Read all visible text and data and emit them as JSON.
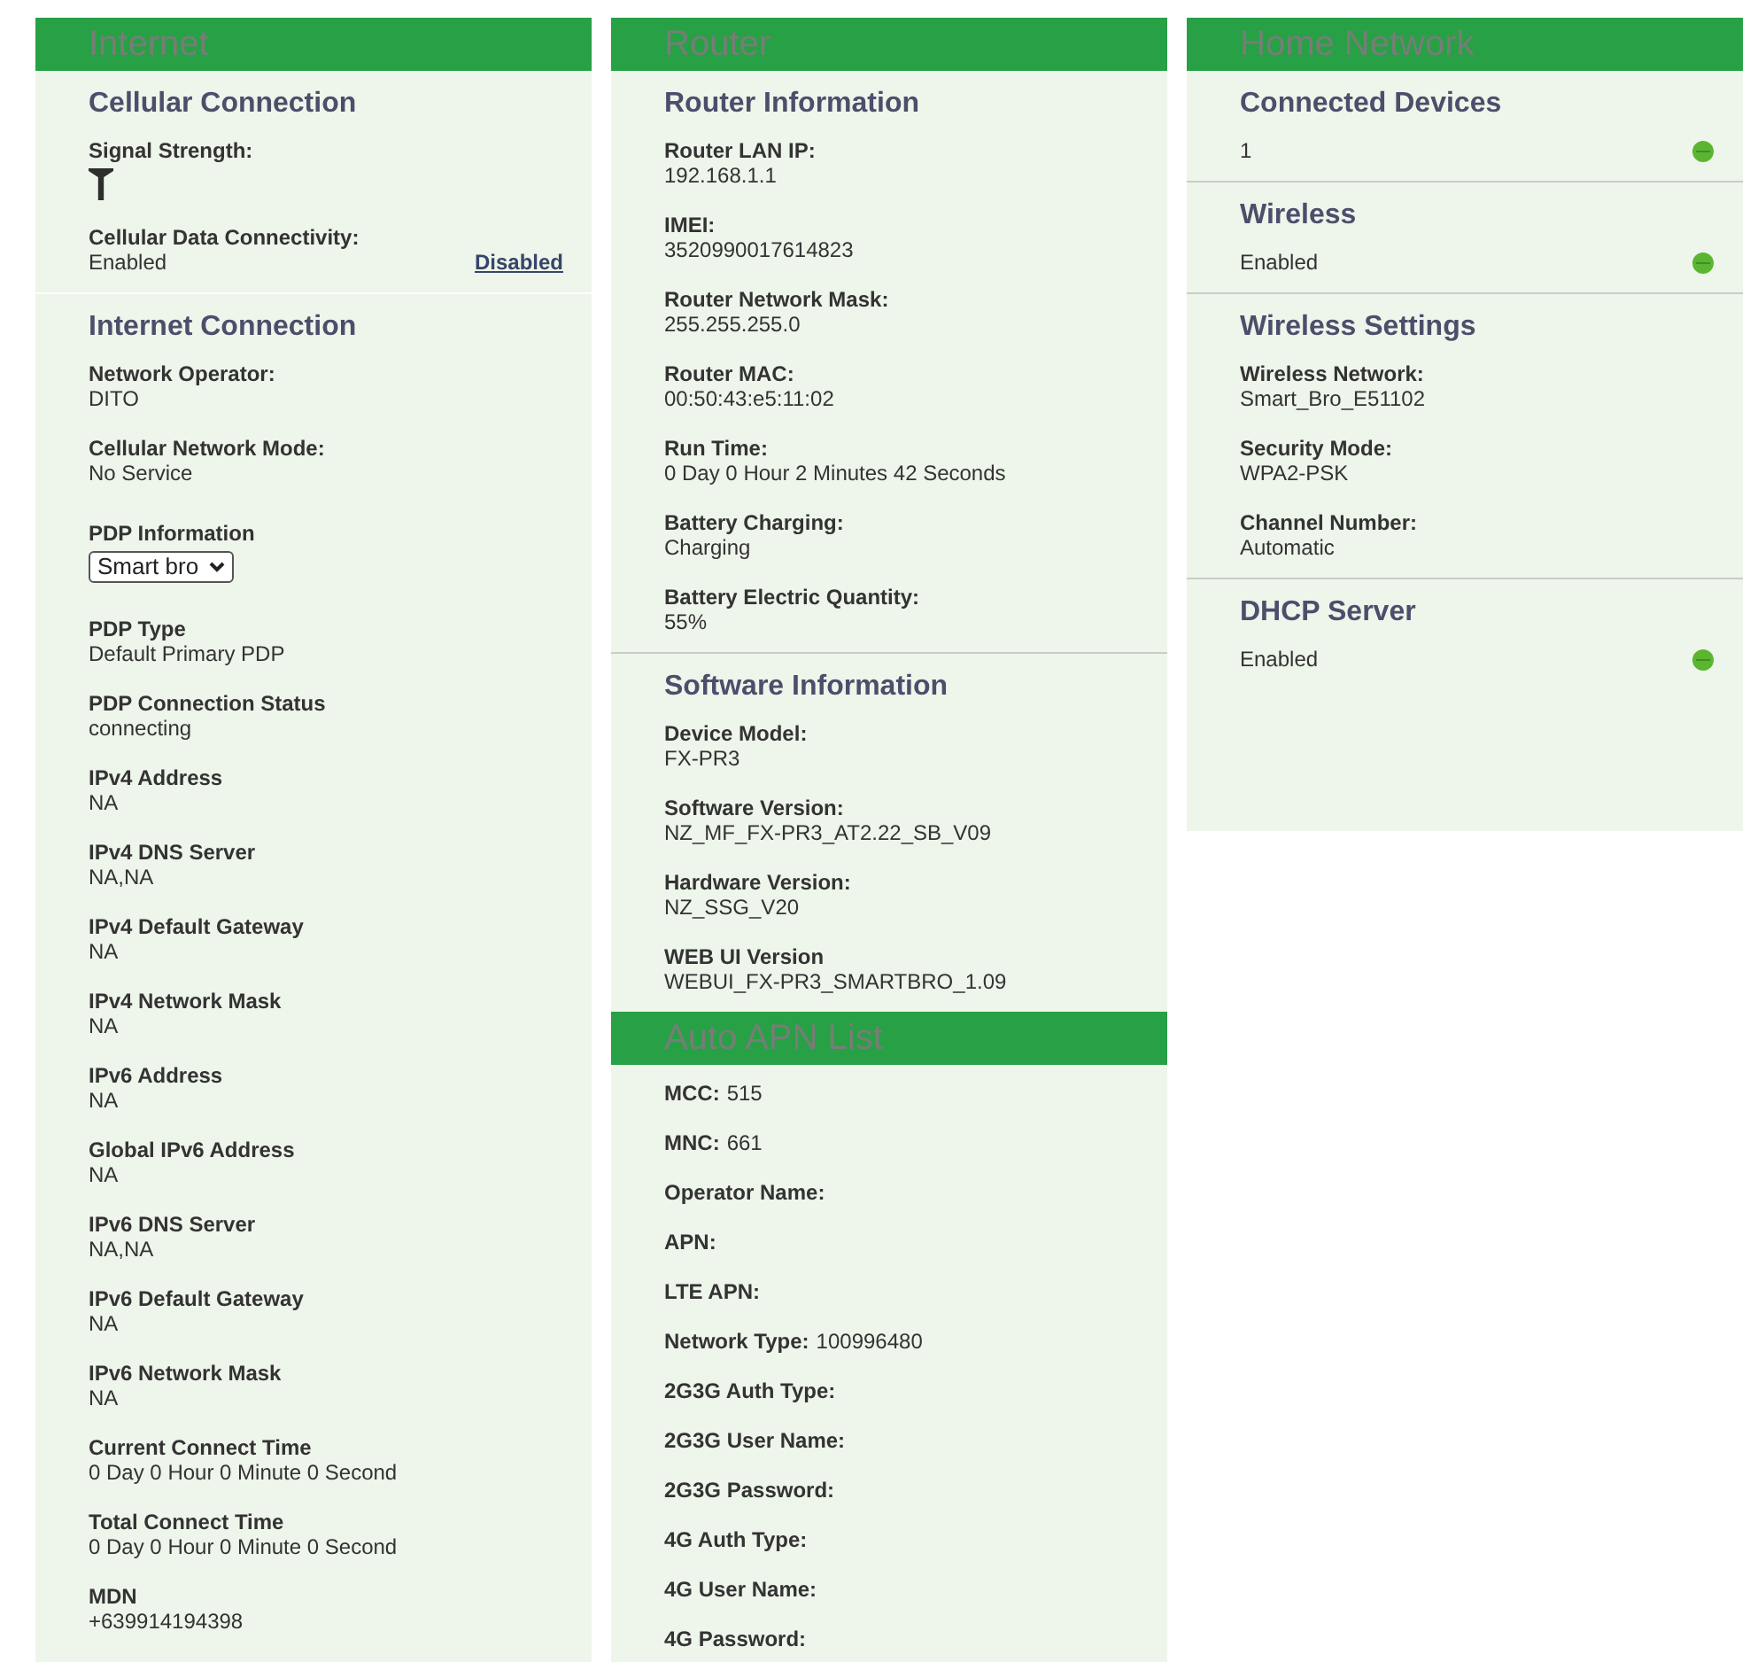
{
  "columns": [
    {
      "panels": [
        {
          "title": "Internet",
          "sections": [
            {
              "title": "Cellular Connection",
              "fields": [
                {
                  "kind": "signal",
                  "label": "Signal Strength:"
                },
                {
                  "kind": "toggle",
                  "label": "Cellular Data Connectivity:",
                  "value": "Enabled",
                  "action": "Disabled"
                }
              ]
            },
            {
              "title": "Internet Connection",
              "fields": [
                {
                  "kind": "text",
                  "label": "Network Operator:",
                  "value": "DITO"
                },
                {
                  "kind": "text",
                  "label": "Cellular Network Mode:",
                  "value": "No Service"
                },
                {
                  "kind": "select",
                  "label": "PDP Information",
                  "value": "Smart bro"
                },
                {
                  "kind": "text",
                  "label": "PDP Type",
                  "value": "Default Primary PDP"
                },
                {
                  "kind": "text",
                  "label": "PDP Connection Status",
                  "value": "connecting"
                },
                {
                  "kind": "text",
                  "label": "IPv4 Address",
                  "value": "NA"
                },
                {
                  "kind": "text",
                  "label": "IPv4 DNS Server",
                  "value": "NA,NA"
                },
                {
                  "kind": "text",
                  "label": "IPv4 Default Gateway",
                  "value": "NA"
                },
                {
                  "kind": "text",
                  "label": "IPv4 Network Mask",
                  "value": "NA"
                },
                {
                  "kind": "text",
                  "label": "IPv6 Address",
                  "value": "NA"
                },
                {
                  "kind": "text",
                  "label": "Global IPv6 Address",
                  "value": "NA"
                },
                {
                  "kind": "text",
                  "label": "IPv6 DNS Server",
                  "value": "NA,NA"
                },
                {
                  "kind": "text",
                  "label": "IPv6 Default Gateway",
                  "value": "NA"
                },
                {
                  "kind": "text",
                  "label": "IPv6 Network Mask",
                  "value": "NA"
                },
                {
                  "kind": "text",
                  "label": "Current Connect Time",
                  "value": "0 Day 0 Hour 0 Minute 0 Second"
                },
                {
                  "kind": "text",
                  "label": "Total Connect Time",
                  "value": "0 Day 0 Hour 0 Minute 0 Second"
                },
                {
                  "kind": "text",
                  "label": "MDN",
                  "value": "+639914194398"
                }
              ]
            }
          ]
        }
      ]
    },
    {
      "panels": [
        {
          "title": "Router",
          "sections": [
            {
              "title": "Router Information",
              "fields": [
                {
                  "kind": "text",
                  "label": "Router LAN IP:",
                  "value": "192.168.1.1"
                },
                {
                  "kind": "text",
                  "label": "IMEI:",
                  "value": "3520990017614823"
                },
                {
                  "kind": "text",
                  "label": "Router Network Mask:",
                  "value": "255.255.255.0"
                },
                {
                  "kind": "text",
                  "label": "Router MAC:",
                  "value": "00:50:43:e5:11:02"
                },
                {
                  "kind": "text",
                  "label": "Run Time:",
                  "value": "0 Day 0 Hour 2 Minutes 42 Seconds"
                },
                {
                  "kind": "text",
                  "label": "Battery Charging:",
                  "value": "Charging"
                },
                {
                  "kind": "text",
                  "label": "Battery Electric Quantity:",
                  "value": "55%"
                }
              ]
            },
            {
              "title": "Software Information",
              "fields": [
                {
                  "kind": "text",
                  "label": "Device Model:",
                  "value": "FX-PR3"
                },
                {
                  "kind": "text",
                  "label": "Software Version:",
                  "value": "NZ_MF_FX-PR3_AT2.22_SB_V09"
                },
                {
                  "kind": "text",
                  "label": "Hardware Version:",
                  "value": "NZ_SSG_V20"
                },
                {
                  "kind": "text",
                  "label": "WEB UI Version",
                  "value": "WEBUI_FX-PR3_SMARTBRO_1.09"
                }
              ]
            }
          ]
        },
        {
          "title": "Auto APN List",
          "sections": [
            {
              "fields": [
                {
                  "kind": "inline",
                  "label": "MCC:",
                  "value": "515"
                },
                {
                  "kind": "inline",
                  "label": "MNC:",
                  "value": "661"
                },
                {
                  "kind": "inline",
                  "label": "Operator Name:"
                },
                {
                  "kind": "inline",
                  "label": "APN:"
                },
                {
                  "kind": "inline",
                  "label": "LTE APN:"
                },
                {
                  "kind": "inline",
                  "label": "Network Type:",
                  "value": "100996480"
                },
                {
                  "kind": "inline",
                  "label": "2G3G Auth Type:"
                },
                {
                  "kind": "inline",
                  "label": "2G3G User Name:"
                },
                {
                  "kind": "inline",
                  "label": "2G3G Password:"
                },
                {
                  "kind": "inline",
                  "label": "4G Auth Type:"
                },
                {
                  "kind": "inline",
                  "label": "4G User Name:"
                },
                {
                  "kind": "inline",
                  "label": "4G Password:"
                }
              ]
            }
          ]
        }
      ]
    },
    {
      "panels": [
        {
          "title": "Home Network",
          "sections": [
            {
              "title": "Connected Devices",
              "fields": [
                {
                  "kind": "status",
                  "value": "1",
                  "on": true
                }
              ]
            },
            {
              "title": "Wireless",
              "fields": [
                {
                  "kind": "status",
                  "value": "Enabled",
                  "on": true
                }
              ]
            },
            {
              "title": "Wireless Settings",
              "fields": [
                {
                  "kind": "text",
                  "label": "Wireless Network:",
                  "value": "Smart_Bro_E51102"
                },
                {
                  "kind": "text",
                  "label": "Security Mode:",
                  "value": "WPA2-PSK"
                },
                {
                  "kind": "text",
                  "label": "Channel Number:",
                  "value": "Automatic"
                }
              ]
            },
            {
              "title": "DHCP Server",
              "fields": [
                {
                  "kind": "status",
                  "value": "Enabled",
                  "on": true
                }
              ]
            }
          ]
        }
      ]
    }
  ]
}
